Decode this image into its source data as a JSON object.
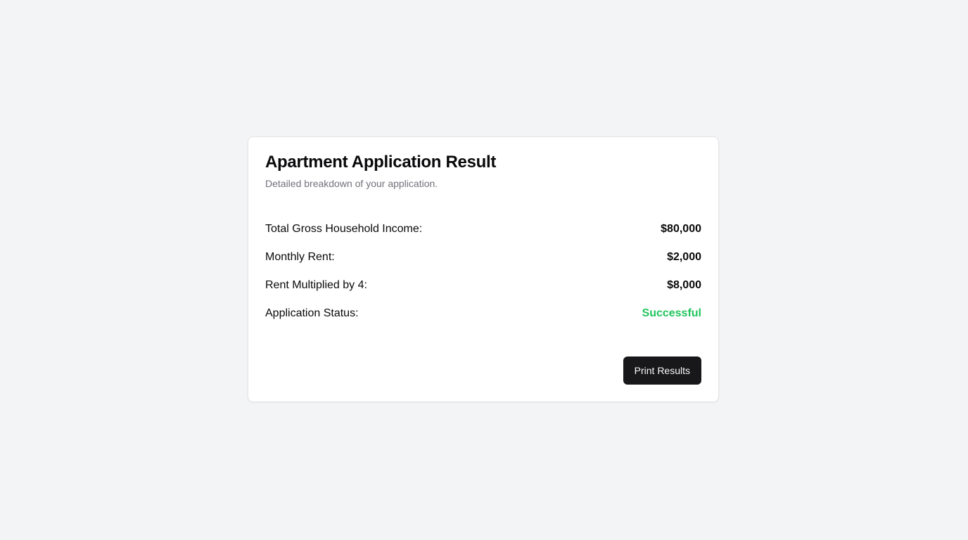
{
  "card": {
    "title": "Apartment Application Result",
    "subtitle": "Detailed breakdown of your application."
  },
  "rows": [
    {
      "label": "Total Gross Household Income:",
      "value": "$80,000"
    },
    {
      "label": "Monthly Rent:",
      "value": "$2,000"
    },
    {
      "label": "Rent Multiplied by 4:",
      "value": "$8,000"
    },
    {
      "label": "Application Status:",
      "value": "Successful",
      "status_color": "#22c55e"
    }
  ],
  "actions": {
    "print_label": "Print Results"
  },
  "colors": {
    "background": "#f3f4f6",
    "card": "#ffffff",
    "button": "#18181b",
    "success": "#22c55e"
  }
}
